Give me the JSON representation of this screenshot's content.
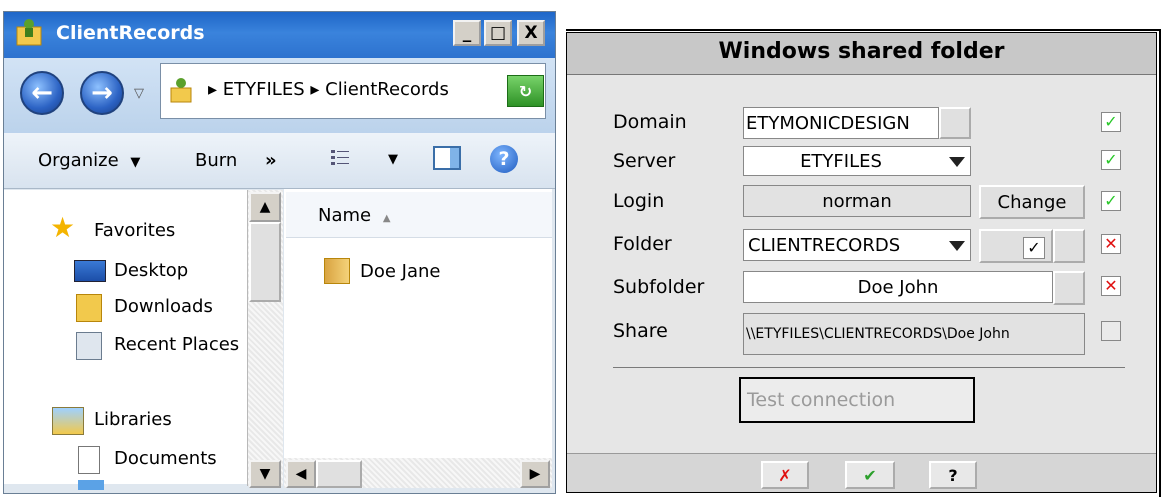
{
  "explorer": {
    "title": "ClientRecords",
    "caption_buttons": [
      "_",
      "□",
      "X"
    ],
    "address": {
      "root": "ETYFILES",
      "folder": "ClientRecords",
      "separator": "▸"
    },
    "toolbar": {
      "organize": "Organize",
      "burn": "Burn",
      "more": "»"
    },
    "nav": {
      "favorites": "Favorites",
      "desktop": "Desktop",
      "downloads": "Downloads",
      "recent": "Recent Places",
      "libraries": "Libraries",
      "documents": "Documents"
    },
    "file_list": {
      "name_header": "Name",
      "items": [
        "Doe Jane"
      ]
    }
  },
  "dialog": {
    "title": "Windows shared folder",
    "labels": {
      "domain": "Domain",
      "server": "Server",
      "login": "Login",
      "folder": "Folder",
      "subfolder": "Subfolder",
      "share": "Share"
    },
    "domain_value": "ETYMONICDESIGN",
    "server_value": "ETYFILES",
    "login_value": "norman",
    "change_label": "Change",
    "folder_value": "CLIENTRECORDS",
    "subfolder_value": "Doe John",
    "share_value": "\\\\ETYFILES\\CLIENTRECORDS\\Doe John",
    "test_connection": "Test connection",
    "status_marks": {
      "ok": "✓",
      "fail": "✕"
    },
    "status_colors": {
      "ok": "#28c828",
      "fail": "#e01010"
    },
    "footer": {
      "cancel": "✗",
      "ok": "✔",
      "help": "?"
    }
  }
}
